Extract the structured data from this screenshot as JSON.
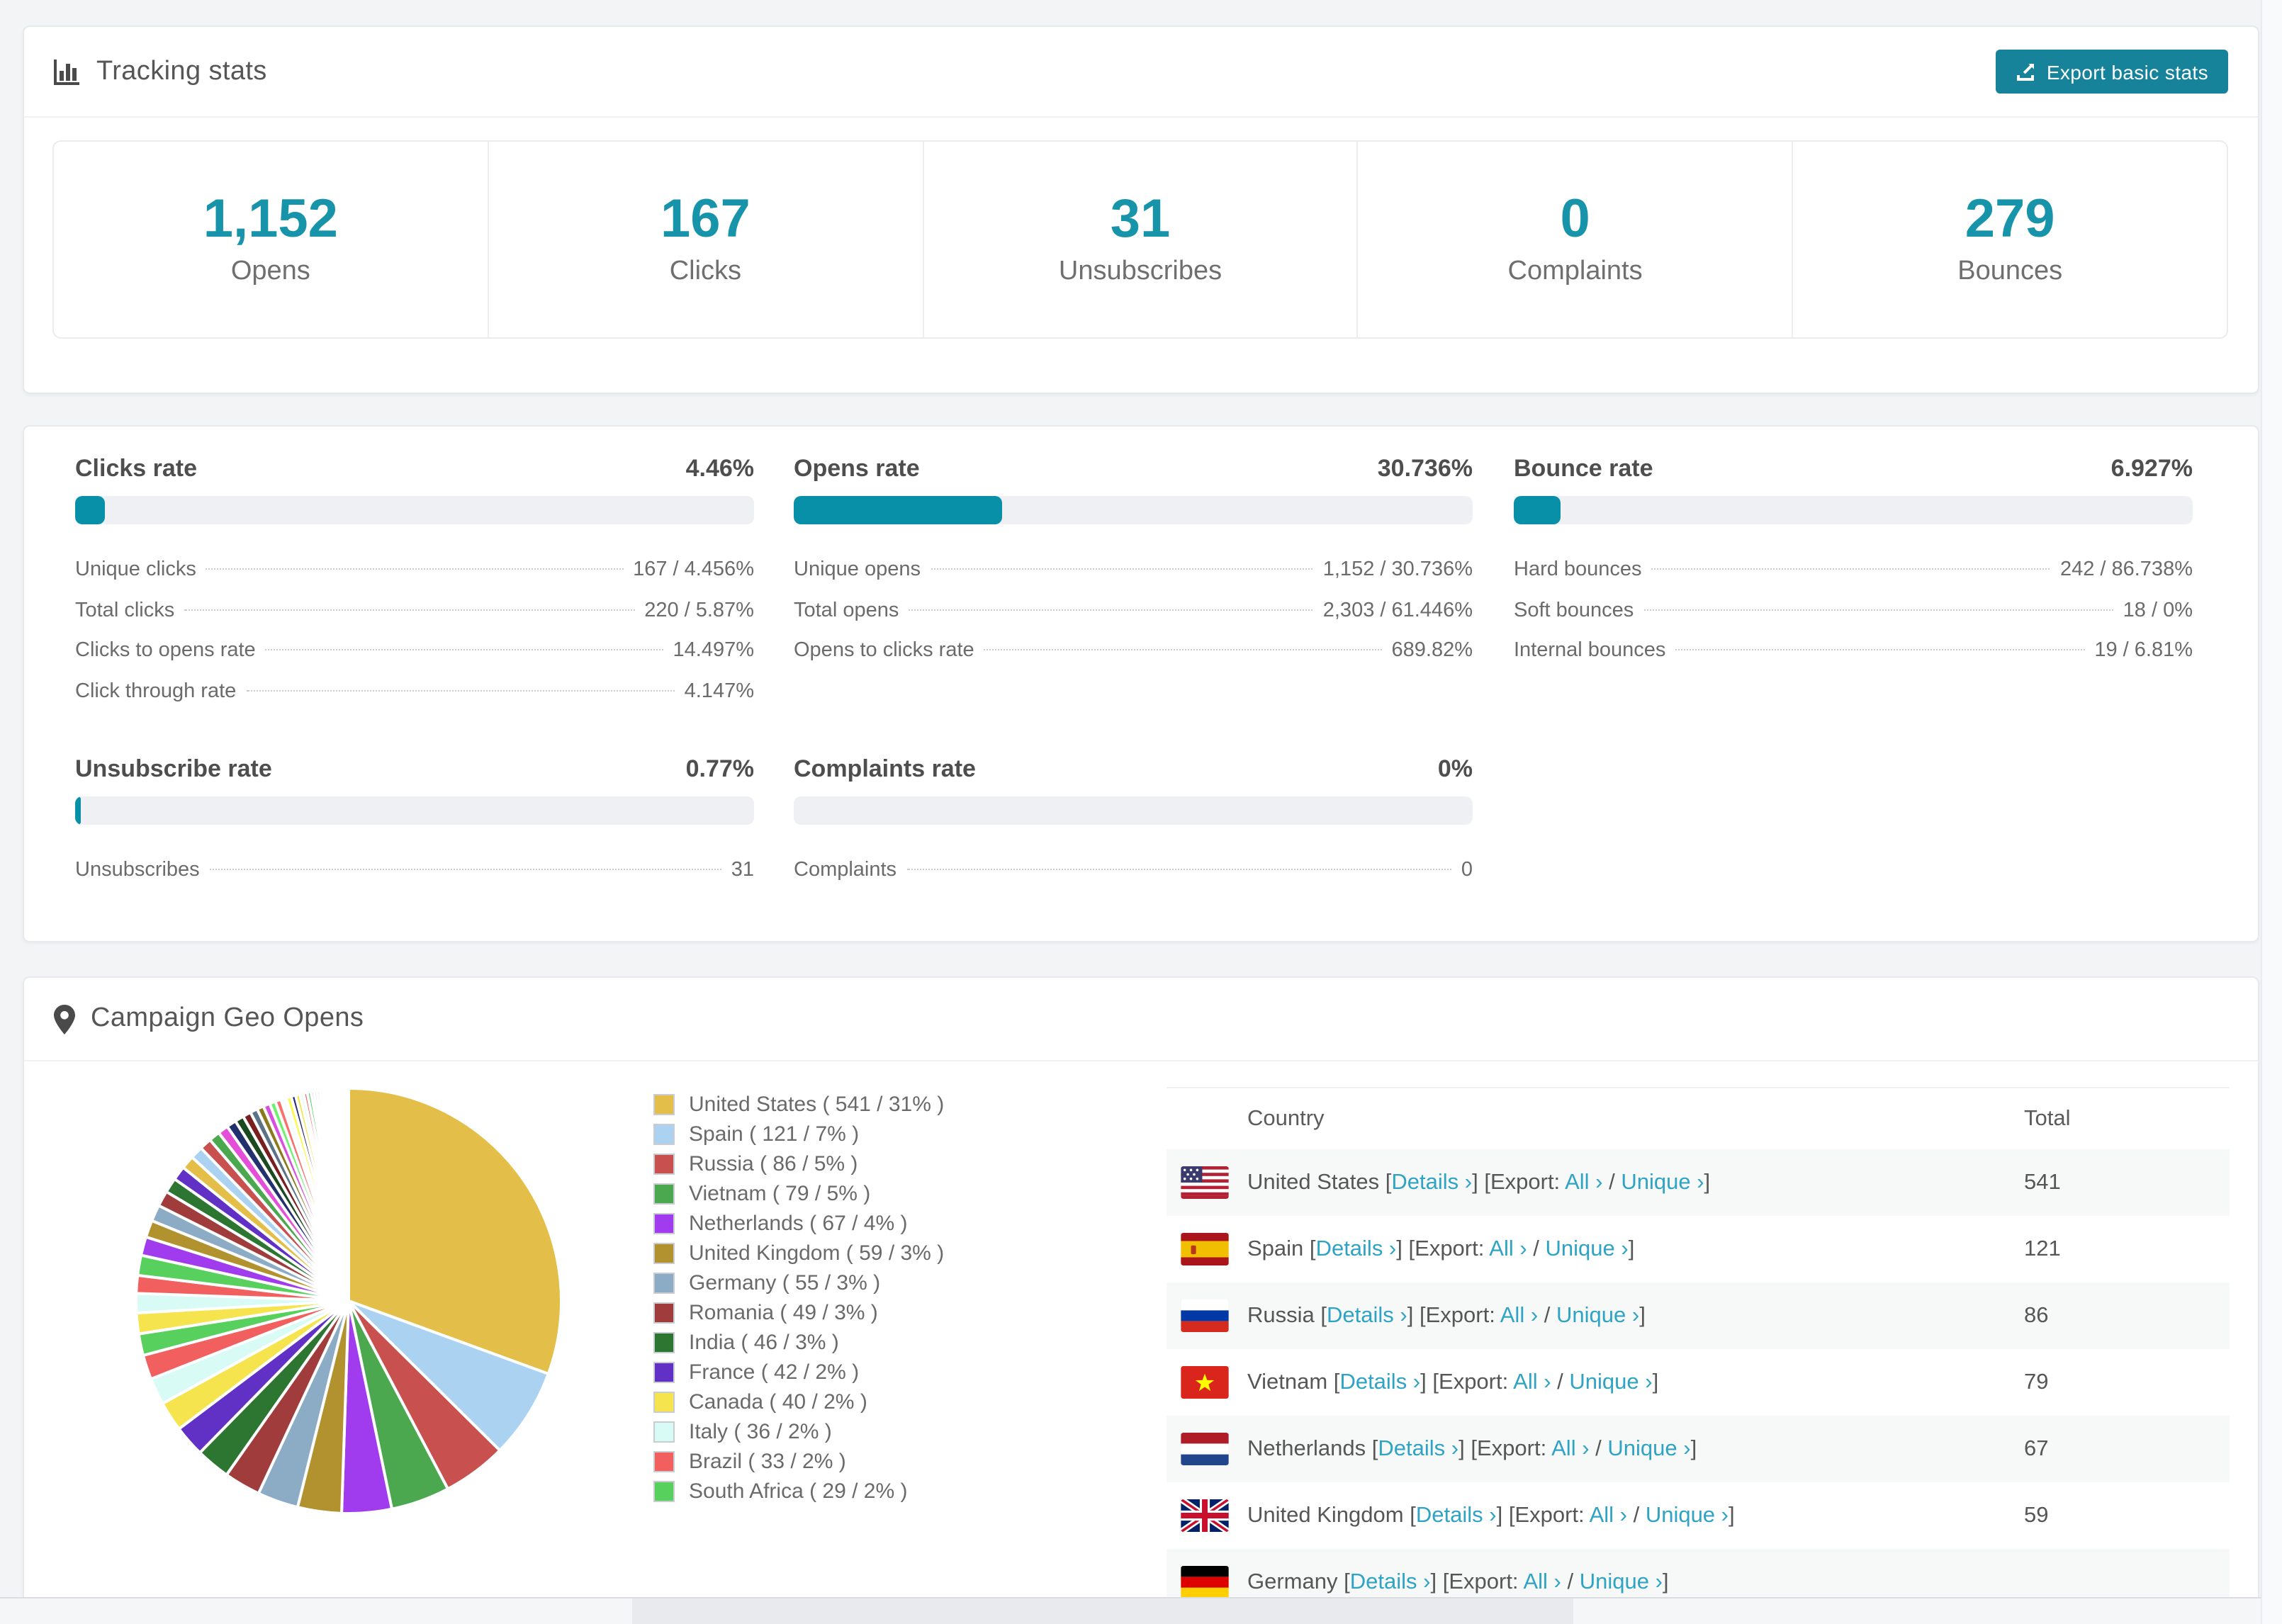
{
  "colors": {
    "accent_teal": "#0790a7",
    "number_teal": "#1794aa",
    "button_teal": "#16839a",
    "link_teal": "#2fa3c4",
    "track_gray": "#eef0f4",
    "row_stripe": "#f7f8f8"
  },
  "tracking": {
    "title": "Tracking stats",
    "export_button": "Export basic stats",
    "stats": [
      {
        "value": "1,152",
        "label": "Opens"
      },
      {
        "value": "167",
        "label": "Clicks"
      },
      {
        "value": "31",
        "label": "Unsubscribes"
      },
      {
        "value": "0",
        "label": "Complaints"
      },
      {
        "value": "279",
        "label": "Bounces"
      }
    ]
  },
  "rates": [
    {
      "title": "Clicks rate",
      "value": "4.46%",
      "percent": 4.46,
      "pos": "c1r1",
      "rows": [
        {
          "label": "Unique clicks",
          "value": "167 / 4.456%"
        },
        {
          "label": "Total clicks",
          "value": "220 / 5.87%"
        },
        {
          "label": "Clicks to opens rate",
          "value": "14.497%"
        },
        {
          "label": "Click through rate",
          "value": "4.147%"
        }
      ]
    },
    {
      "title": "Opens rate",
      "value": "30.736%",
      "percent": 30.736,
      "pos": "c2r1",
      "rows": [
        {
          "label": "Unique opens",
          "value": "1,152 / 30.736%"
        },
        {
          "label": "Total opens",
          "value": "2,303 / 61.446%"
        },
        {
          "label": "Opens to clicks rate",
          "value": "689.82%"
        }
      ]
    },
    {
      "title": "Bounce rate",
      "value": "6.927%",
      "percent": 6.927,
      "pos": "c3r1",
      "rows": [
        {
          "label": "Hard bounces",
          "value": "242 / 86.738%"
        },
        {
          "label": "Soft bounces",
          "value": "18 / 0%"
        },
        {
          "label": "Internal bounces",
          "value": "19 / 6.81%"
        }
      ]
    },
    {
      "title": "Unsubscribe rate",
      "value": "0.77%",
      "percent": 0.77,
      "pos": "c1r2",
      "rows": [
        {
          "label": "Unsubscribes",
          "value": "31"
        }
      ]
    },
    {
      "title": "Complaints rate",
      "value": "0%",
      "percent": 0,
      "pos": "c2r2",
      "rows": [
        {
          "label": "Complaints",
          "value": "0"
        }
      ]
    }
  ],
  "geo": {
    "title": "Campaign Geo Opens",
    "legend": [
      {
        "display": "United States ( 541 / 31% )",
        "color": "#e3be48"
      },
      {
        "display": "Spain ( 121 / 7% )",
        "color": "#abd3f1"
      },
      {
        "display": "Russia ( 86 / 5% )",
        "color": "#c8504e"
      },
      {
        "display": "Vietnam ( 79 / 5% )",
        "color": "#4ba84f"
      },
      {
        "display": "Netherlands ( 67 / 4% )",
        "color": "#a03bee"
      },
      {
        "display": "United Kingdom ( 59 / 3% )",
        "color": "#b2922e"
      },
      {
        "display": "Germany ( 55 / 3% )",
        "color": "#8cabc4"
      },
      {
        "display": "Romania ( 49 / 3% )",
        "color": "#a03c3c"
      },
      {
        "display": "India ( 46 / 3% )",
        "color": "#2c7631"
      },
      {
        "display": "France ( 42 / 2% )",
        "color": "#6130c4"
      },
      {
        "display": "Canada ( 40 / 2% )",
        "color": "#f6e44e"
      },
      {
        "display": "Italy ( 36 / 2% )",
        "color": "#d8fbf6"
      },
      {
        "display": "Brazil ( 33 / 2% )",
        "color": "#f15f5f"
      },
      {
        "display": "South Africa ( 29 / 2% )",
        "color": "#57d05e"
      }
    ],
    "table": {
      "headers": {
        "country": "Country",
        "total": "Total"
      },
      "bracket_open": "[",
      "bracket_close": "]",
      "export_prefix": "[Export:",
      "slash": " / ",
      "link_details": "Details ›",
      "link_all": "All ›",
      "link_unique": "Unique ›",
      "rows": [
        {
          "country": "United States",
          "total": "541",
          "flag": "us"
        },
        {
          "country": "Spain",
          "total": "121",
          "flag": "es"
        },
        {
          "country": "Russia",
          "total": "86",
          "flag": "ru"
        },
        {
          "country": "Vietnam",
          "total": "79",
          "flag": "vn"
        },
        {
          "country": "Netherlands",
          "total": "67",
          "flag": "nl"
        },
        {
          "country": "United Kingdom",
          "total": "59",
          "flag": "gb"
        },
        {
          "country": "Germany",
          "total": "",
          "flag": "de",
          "partial": true
        }
      ]
    }
  },
  "chart_data": {
    "type": "pie",
    "title": "Campaign Geo Opens",
    "legend_position": "right",
    "start_angle_deg": -90,
    "direction": "clockwise",
    "series": [
      {
        "name": "United States",
        "value": 541,
        "pct": "31%"
      },
      {
        "name": "Spain",
        "value": 121,
        "pct": "7%"
      },
      {
        "name": "Russia",
        "value": 86,
        "pct": "5%"
      },
      {
        "name": "Vietnam",
        "value": 79,
        "pct": "5%"
      },
      {
        "name": "Netherlands",
        "value": 67,
        "pct": "4%"
      },
      {
        "name": "United Kingdom",
        "value": 59,
        "pct": "3%"
      },
      {
        "name": "Germany",
        "value": 55,
        "pct": "3%"
      },
      {
        "name": "Romania",
        "value": 49,
        "pct": "3%"
      },
      {
        "name": "India",
        "value": 46,
        "pct": "3%"
      },
      {
        "name": "France",
        "value": 42,
        "pct": "2%"
      },
      {
        "name": "Canada",
        "value": 40,
        "pct": "2%"
      },
      {
        "name": "Italy",
        "value": 36,
        "pct": "2%"
      },
      {
        "name": "Brazil",
        "value": 33,
        "pct": "2%"
      },
      {
        "name": "South Africa",
        "value": 29,
        "pct": "2%"
      }
    ],
    "others_values": [
      28,
      26,
      24,
      27,
      25,
      23,
      22,
      21,
      20,
      19,
      18,
      17,
      16,
      15,
      14,
      13,
      12,
      11,
      10,
      9,
      9,
      8,
      8,
      7,
      7,
      6,
      6,
      5,
      5,
      5,
      4,
      4,
      4,
      3,
      3,
      3,
      3,
      2,
      2,
      2,
      2,
      2,
      2,
      1.5,
      1.5,
      1.2,
      1,
      1,
      1,
      1,
      0.8,
      0.8,
      0.7,
      0.6,
      0.5,
      0.5,
      0.4,
      0.4,
      0.3,
      0.3,
      0.2,
      0.2,
      0.2,
      0.1,
      0.1
    ],
    "others_palette": [
      "#f6e44e",
      "#d8fbf6",
      "#f15f5f",
      "#57d05e",
      "#a03bee",
      "#b2922e",
      "#8cabc4",
      "#a03c3c",
      "#2c7631",
      "#6130c4",
      "#e3be48",
      "#abd3f1",
      "#c8504e",
      "#4ba84f",
      "#e44fd9",
      "#23306e",
      "#1b4a21",
      "#7a1f1f",
      "#5c7287",
      "#8a7a1e",
      "#d94fe0",
      "#6ff06f",
      "#fb6f6f",
      "#f2fdff",
      "#fdf84a",
      "#2c2c7a"
    ]
  }
}
